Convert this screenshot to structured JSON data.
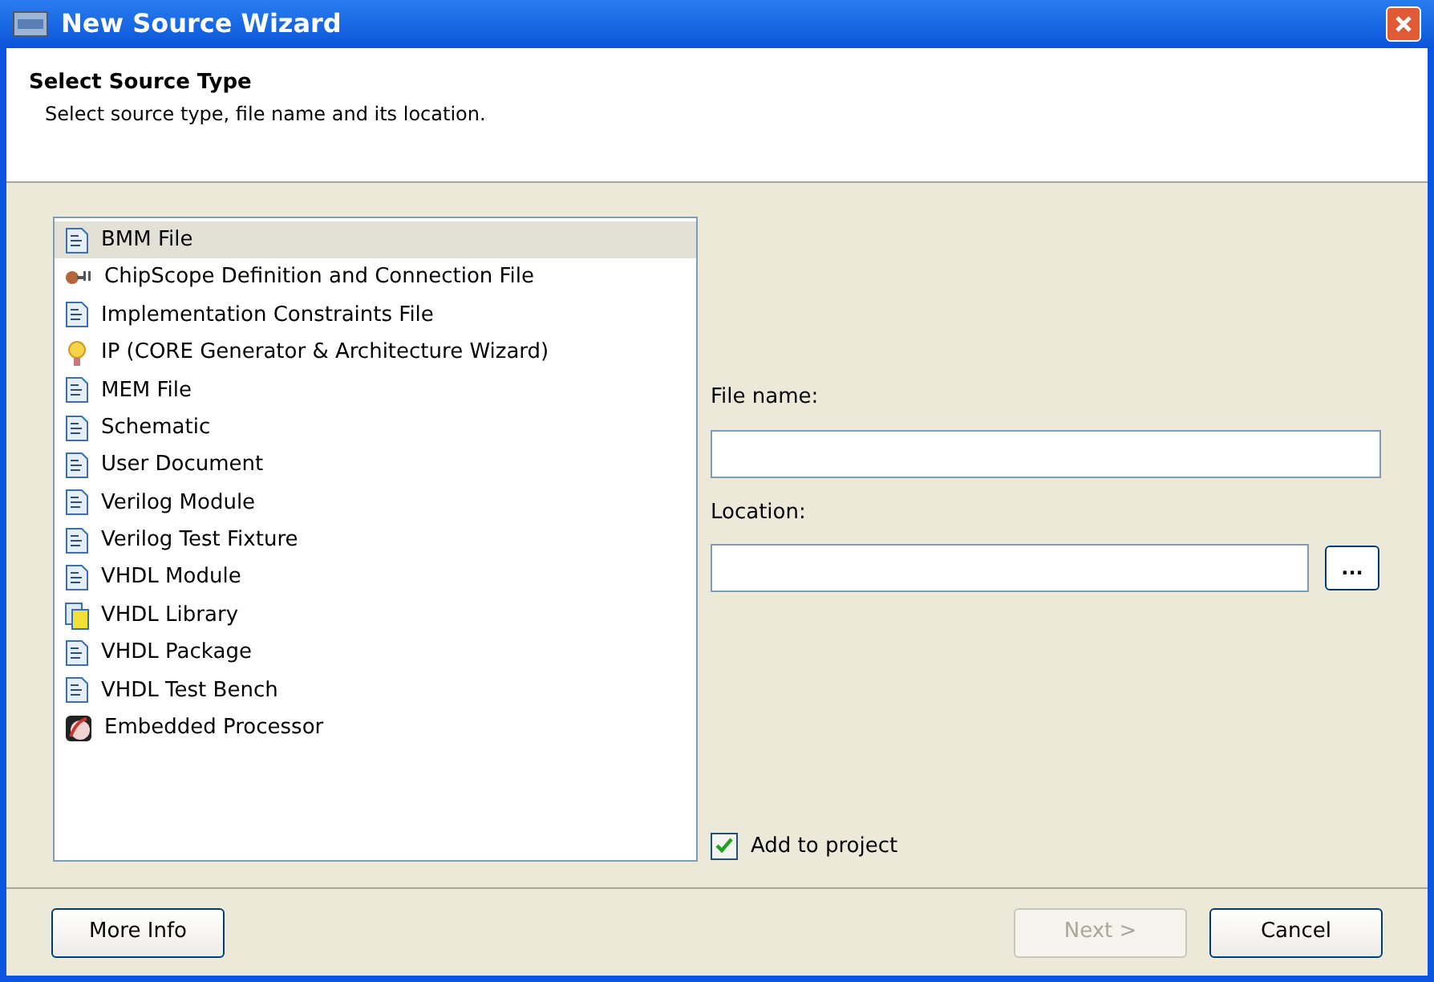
{
  "window": {
    "title": "New Source Wizard"
  },
  "header": {
    "title": "Select Source Type",
    "subtitle": "Select source type, file name and its location."
  },
  "source_types": [
    {
      "label": "BMM File",
      "selected": true
    },
    {
      "label": "ChipScope Definition and Connection File",
      "selected": false
    },
    {
      "label": "Implementation Constraints File",
      "selected": false
    },
    {
      "label": "IP (CORE Generator & Architecture Wizard)",
      "selected": false
    },
    {
      "label": "MEM File",
      "selected": false
    },
    {
      "label": "Schematic",
      "selected": false
    },
    {
      "label": "User Document",
      "selected": false
    },
    {
      "label": "Verilog Module",
      "selected": false
    },
    {
      "label": "Verilog Test Fixture",
      "selected": false
    },
    {
      "label": "VHDL Module",
      "selected": false
    },
    {
      "label": "VHDL Library",
      "selected": false
    },
    {
      "label": "VHDL Package",
      "selected": false
    },
    {
      "label": "VHDL Test Bench",
      "selected": false
    },
    {
      "label": "Embedded Processor",
      "selected": false
    }
  ],
  "file_name": {
    "label": "File name:"
  },
  "location": {
    "label": "Location:",
    "browse": "..."
  },
  "add_to_project": {
    "label": "Add to project",
    "checked": true
  },
  "buttons": [
    {
      "label": "More Info",
      "disabled": false
    },
    {
      "label": "Next >",
      "disabled": true
    },
    {
      "label": "Cancel",
      "disabled": false
    }
  ]
}
